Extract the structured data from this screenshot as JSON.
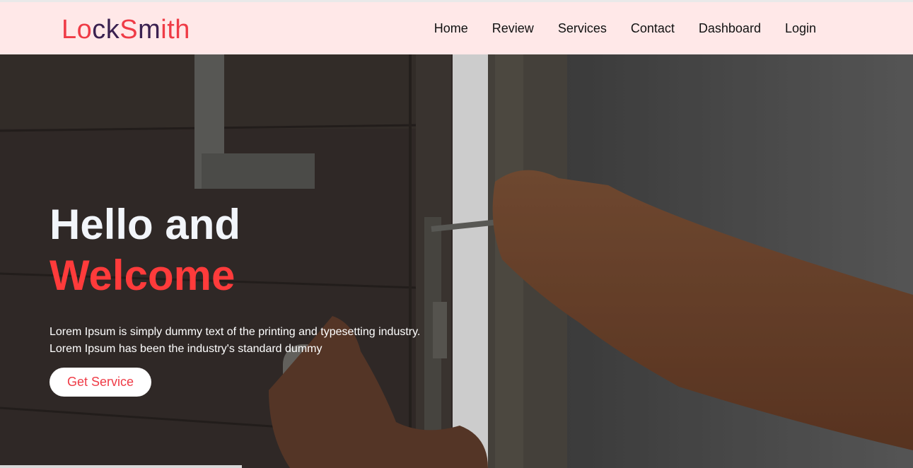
{
  "brand": {
    "part1": "Lo",
    "part2": "ck",
    "part3": "S",
    "part4": "m",
    "part5": "ith"
  },
  "nav": {
    "items": [
      {
        "label": "Home"
      },
      {
        "label": "Review"
      },
      {
        "label": "Services"
      },
      {
        "label": "Contact"
      },
      {
        "label": "Dashboard"
      },
      {
        "label": "Login"
      }
    ]
  },
  "hero": {
    "title_line1": "Hello and",
    "title_line2": "Welcome",
    "description_line1": "Lorem Ipsum is simply dummy text of the printing and typesetting industry.",
    "description_line2": "Lorem Ipsum has been the industry's standard dummy",
    "cta_label": "Get Service"
  },
  "colors": {
    "accent": "#ef3b46",
    "brand_dark": "#3a2150",
    "navbar_bg": "#ffe8e8",
    "hero_title_accent": "#ff3b3b"
  }
}
